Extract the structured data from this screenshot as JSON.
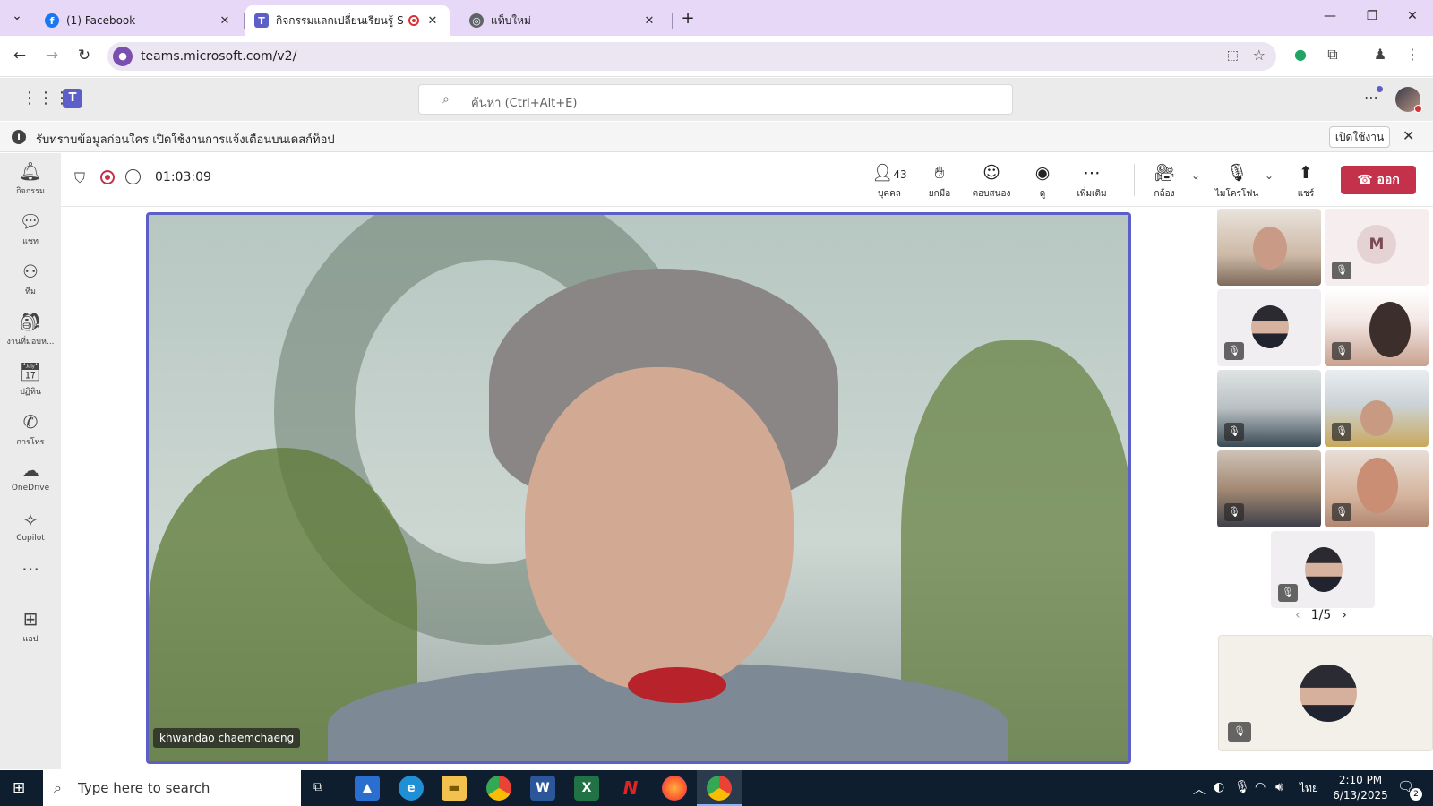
{
  "browser": {
    "tabs": [
      {
        "title": "(1) Facebook",
        "favicon": "facebook-icon"
      },
      {
        "title": "กิจกรรมแลกเปลี่ยนเรียนรู้ SAR",
        "favicon": "teams-icon"
      },
      {
        "title": "แท็บใหม่",
        "favicon": "chrome-icon"
      }
    ],
    "url": "teams.microsoft.com/v2/"
  },
  "teams": {
    "search_placeholder": "ค้นหา (Ctrl+Alt+E)",
    "notice": {
      "text": "รับทราบข้อมูลก่อนใคร เปิดใช้งานการแจ้งเตือนบนเดสก์ท็อป",
      "button": "เปิดใช้งาน"
    },
    "rail": [
      {
        "label": "กิจกรรม",
        "icon": "bell-icon"
      },
      {
        "label": "แชท",
        "icon": "chat-icon"
      },
      {
        "label": "ทีม",
        "icon": "teams-group-icon"
      },
      {
        "label": "งานที่มอบห...",
        "icon": "assignments-icon"
      },
      {
        "label": "ปฏิทิน",
        "icon": "calendar-icon"
      },
      {
        "label": "การโทร",
        "icon": "phone-icon"
      },
      {
        "label": "OneDrive",
        "icon": "cloud-icon"
      },
      {
        "label": "Copilot",
        "icon": "copilot-icon"
      },
      {
        "label": "แอป",
        "icon": "add-app-icon"
      }
    ],
    "meeting": {
      "timer": "01:03:09",
      "people_count": "43",
      "controls": {
        "people": "บุคคล",
        "raise": "ยกมือ",
        "react": "ตอบสนอง",
        "view": "ดู",
        "more": "เพิ่มเติม",
        "camera": "กล้อง",
        "mic": "ไมโครโฟน",
        "share": "แชร์"
      },
      "leave": "ออก",
      "speaker_name": "khwandao chaemchaeng",
      "tile_initial": "M",
      "pager": "1/5"
    }
  },
  "taskbar": {
    "search": "Type here to search",
    "lang": "ไทย",
    "time": "2:10 PM",
    "date": "6/13/2025",
    "notif_count": "2"
  }
}
